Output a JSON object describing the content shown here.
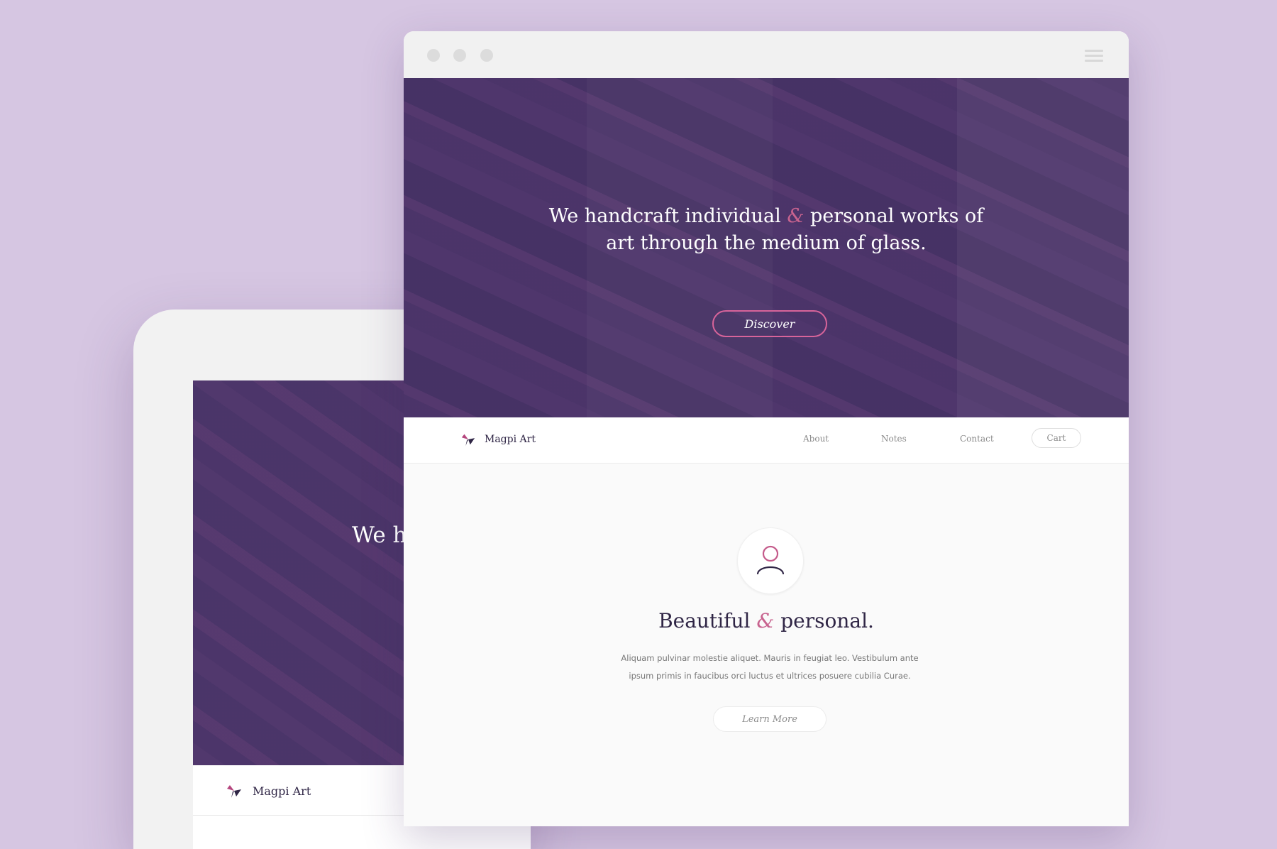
{
  "brand": {
    "name": "Magpi Art"
  },
  "hero": {
    "line1_a": "We handcraft individual",
    "amp": "&",
    "line1_b": "personal works of",
    "line2": "art through the medium of glass.",
    "cta": "Discover"
  },
  "nav": {
    "links": [
      "About",
      "Notes",
      "Contact"
    ],
    "cart": "Cart"
  },
  "feature": {
    "icon": "user-icon",
    "title_a": "Beautiful",
    "amp": "&",
    "title_b": "personal.",
    "body": "Aliquam pulvinar molestie aliquet. Mauris in feugiat leo. Vestibulum ante ipsum primis in faucibus orci luctus et ultrices posuere cubilia Curae.",
    "cta": "Learn More"
  },
  "tablet": {
    "hero_fragment": "We ha",
    "brand": "Magpi Art"
  },
  "colors": {
    "background": "#d6c6e2",
    "hero_overlay": "#463165",
    "accent": "#d8649a",
    "text_dark": "#2f2545"
  }
}
